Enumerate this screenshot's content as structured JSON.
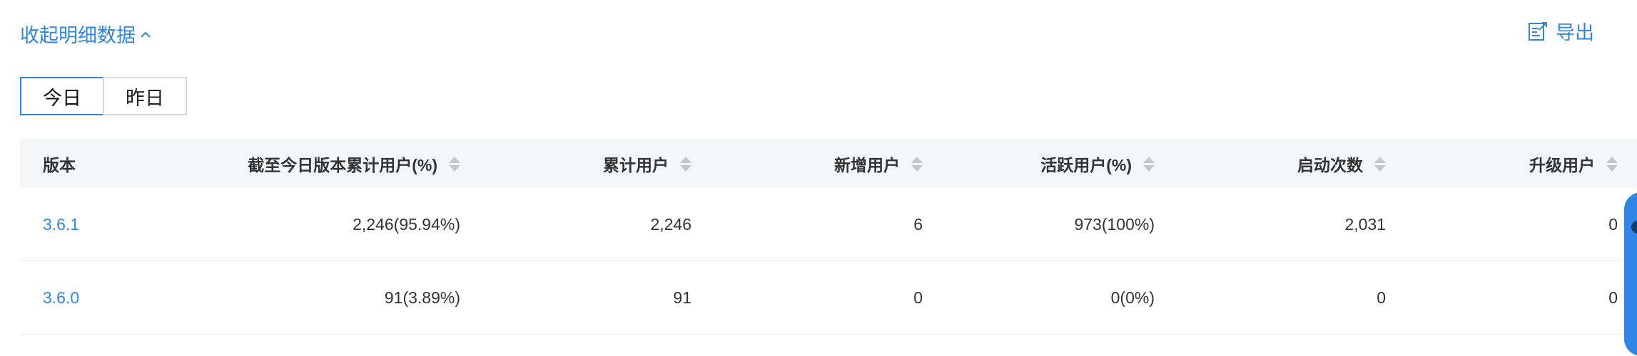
{
  "collapse_label": "收起明细数据",
  "export_label": "导出",
  "tabs": [
    {
      "label": "今日",
      "active": true
    },
    {
      "label": "昨日",
      "active": false
    }
  ],
  "table": {
    "headers": [
      "版本",
      "截至今日版本累计用户(%)",
      "累计用户",
      "新增用户",
      "活跃用户(%)",
      "启动次数",
      "升级用户"
    ],
    "rows": [
      [
        "3.6.1",
        "2,246(95.94%)",
        "2,246",
        "6",
        "973(100%)",
        "2,031",
        "0"
      ],
      [
        "3.6.0",
        "91(3.89%)",
        "91",
        "0",
        "0(0%)",
        "0",
        "0"
      ]
    ]
  },
  "colors": {
    "accent": "#2f86e6",
    "header_bg": "#f5f6f8",
    "border": "#d9d9d9"
  }
}
